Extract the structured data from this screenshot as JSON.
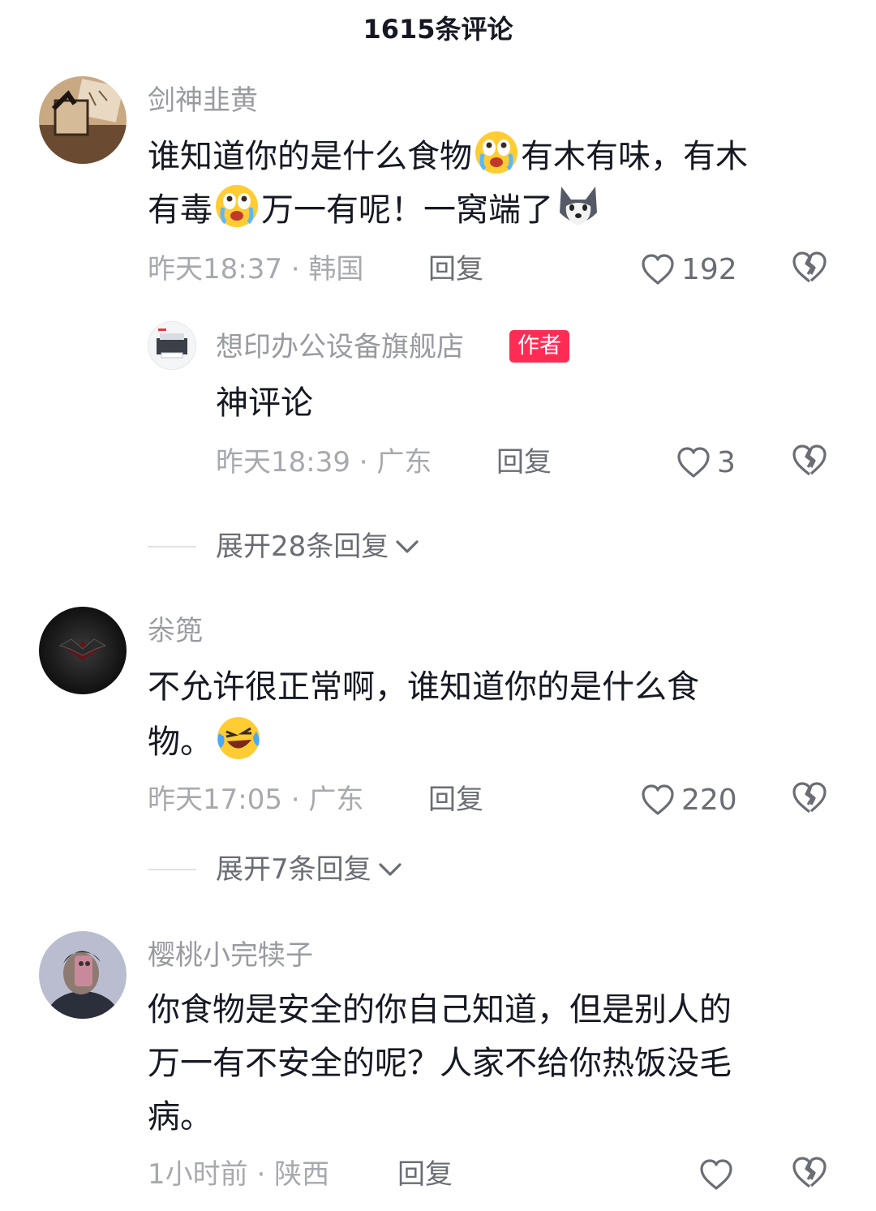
{
  "header": {
    "title": "1615条评论"
  },
  "comments": [
    {
      "username": "剑神韭黄",
      "lines": [
        [
          "谁知道你的是什么食物",
          "[emoji:crying-face]",
          "有木有味，有木"
        ],
        [
          "有毒",
          "[emoji:crying-face]",
          "万一有呢！一窝端了",
          "[emoji:husky-dog]"
        ]
      ],
      "time": "昨天18:37",
      "location": "韩国",
      "reply_label": "回复",
      "likes": "192",
      "reply": {
        "username": "想印办公设备旗舰店",
        "badge": "作者",
        "text": "神评论",
        "time": "昨天18:39",
        "location": "广东",
        "reply_label": "回复",
        "likes": "3"
      },
      "expand": "展开28条回复"
    },
    {
      "username": "尜篼",
      "lines": [
        [
          "不允许很正常啊，谁知道你的是什么食"
        ],
        [
          "物。",
          "[emoji:laughing-tears]"
        ]
      ],
      "time": "昨天17:05",
      "location": "广东",
      "reply_label": "回复",
      "likes": "220",
      "expand": "展开7条回复"
    },
    {
      "username": "樱桃小完犊子",
      "lines": [
        [
          "你食物是安全的你自己知道，但是别人的"
        ],
        [
          "万一有不安全的呢？人家不给你热饭没毛"
        ],
        [
          "病。"
        ]
      ],
      "time": "1小时前",
      "location": "陕西",
      "reply_label": "回复",
      "likes": ""
    }
  ],
  "separator": " · ",
  "icons": {
    "like": "heart-outline-icon",
    "dislike": "broken-heart-icon",
    "expand": "chevron-down-icon"
  },
  "colors": {
    "author_badge": "#fe2c55",
    "username": "#9a9ba1",
    "meta": "#a8a9ae"
  }
}
